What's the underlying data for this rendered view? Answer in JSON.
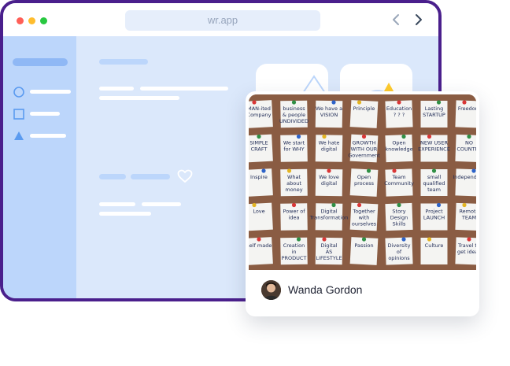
{
  "browser": {
    "url": "wr.app",
    "traffic_lights": [
      "#ff5f57",
      "#ffbd2e",
      "#28c840"
    ],
    "frame_color": "#4a1f8c"
  },
  "content": {
    "like_icon": "heart-icon"
  },
  "card": {
    "author_name": "Wanda Gordon",
    "photo_notes": [
      "MAN-ited Company",
      "business & people UNDIVIDED",
      "We have a VISION",
      "Principle",
      "Education ? ? ?",
      "Lasting STARTUP",
      "Freedom",
      "SIMPLE CRAFT",
      "We start for WHY",
      "We hate digital",
      "GROWTH WITH OUR Government",
      "Open knowledge",
      "NEW USER EXPERIENCE",
      "NO COUNTRY",
      "Inspire",
      "What about money POWER",
      "We love digital",
      "Open process",
      "Team Community",
      "small qualified team",
      "Independent",
      "Love",
      "Power of idea",
      "Digital Transformation",
      "Together with ourselves",
      "Story Design Skills",
      "Project LAUNCH",
      "Remote TEAM",
      "Self made",
      "Creation in PRODUCT development",
      "Digital AS LIFESTYLE",
      "Passion",
      "Diversity of opinions",
      "Culture",
      "Travel to get ideas"
    ]
  }
}
